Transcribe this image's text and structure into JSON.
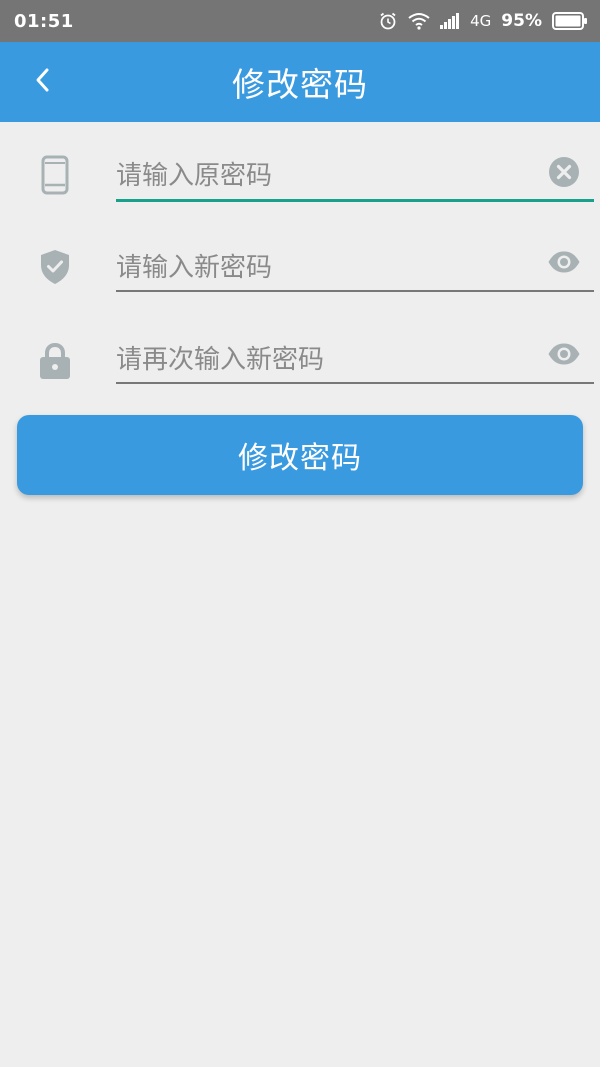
{
  "status_bar": {
    "time": "01:51",
    "network": "4G",
    "battery": "95%",
    "icons": [
      "alarm-icon",
      "wifi-icon",
      "signal-icon",
      "battery-icon"
    ]
  },
  "app_bar": {
    "title": "修改密码",
    "back_icon": "chevron-left-icon"
  },
  "form": {
    "old_password": {
      "placeholder": "请输入原密码",
      "value": "",
      "icon": "phone-icon",
      "action_icon": "clear-icon"
    },
    "new_password": {
      "placeholder": "请输入新密码",
      "value": "",
      "icon": "shield-check-icon",
      "action_icon": "eye-icon"
    },
    "confirm_password": {
      "placeholder": "请再次输入新密码",
      "value": "",
      "icon": "lock-icon",
      "action_icon": "eye-icon"
    },
    "submit_label": "修改密码"
  },
  "colors": {
    "primary": "#3a9ae0",
    "status_bar": "#757575",
    "background": "#eeeeee",
    "active_underline": "#17a08a",
    "icon_gray": "#a8b2b4"
  }
}
